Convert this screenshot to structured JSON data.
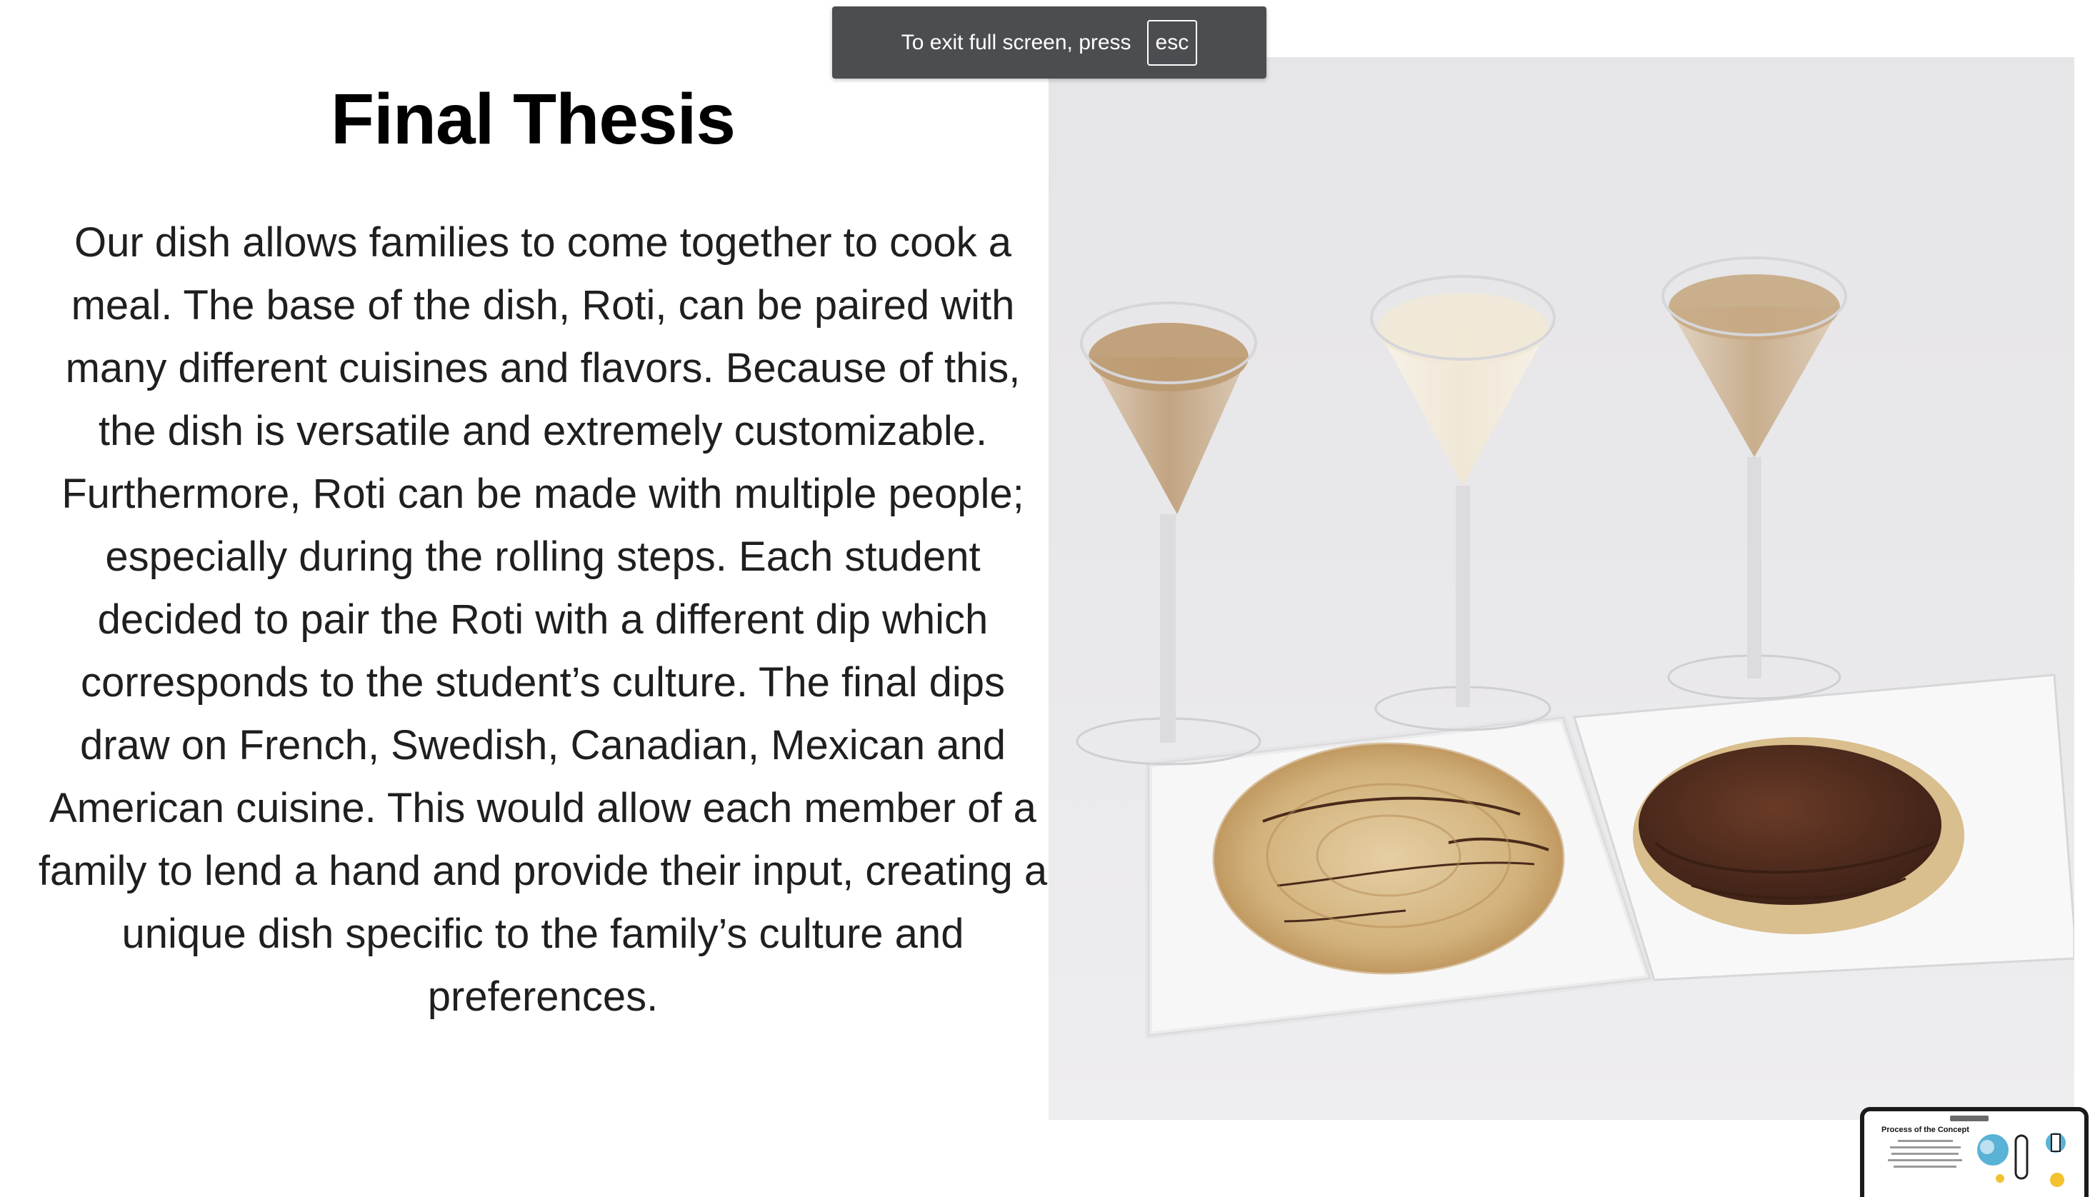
{
  "fullscreen_notice": {
    "text": "To exit full screen, press",
    "key": "esc"
  },
  "slide": {
    "title": "Final Thesis",
    "body": "Our dish allows families to come together to cook a meal. The base of the dish, Roti, can be paired with many different cuisines and flavors. Because of this, the dish is versatile and extremely customizable. Furthermore, Roti can be made with multiple people; especially during the rolling steps. Each student decided to pair the Roti with a different dip which corresponds to the student’s culture. The final dips draw on French, Swedish, Canadian, Mexican and American cuisine. This would allow each member of a family to lend a hand and provide their input, creating a unique dish specific to the family’s culture and preferences."
  },
  "next_slide_preview": {
    "title": "Process of the Concept"
  },
  "colors": {
    "toast_background": "#4c4d51",
    "photo_background": "#e6e5e7",
    "title_text": "#000000",
    "body_text": "#1f1f1f"
  }
}
